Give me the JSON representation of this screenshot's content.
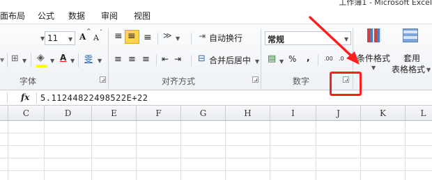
{
  "window": {
    "title_fragment": "工作簿1 - Microsoft Excel"
  },
  "tabs": [
    "面布局",
    "公式",
    "数据",
    "审阅",
    "视图"
  ],
  "font_group": {
    "font_size": "11",
    "grow_font": "A",
    "shrink_font": "A",
    "font_color_letter": "A",
    "phonetic": "雯",
    "label": "字体"
  },
  "alignment_group": {
    "orientation": "≫",
    "wrap_text": "自动换行",
    "merge_center": "合并后居中",
    "label": "对齐方式"
  },
  "number_group": {
    "format": "常规",
    "percent": "%",
    "comma": ",",
    "increase_decimal": ".00",
    "decrease_decimal": ".0",
    "label": "数字"
  },
  "styles_group": {
    "conditional_formatting": "条件格式",
    "format_as_table_line1": "套用",
    "format_as_table_line2": "表格格式"
  },
  "formula_bar": {
    "fx": "fx",
    "value": "5.11244822498522E+22"
  },
  "columns": [
    "C",
    "D",
    "E",
    "F",
    "G",
    "H",
    "I",
    "J",
    "K",
    "L"
  ],
  "colors": {
    "annotation_red": "#ff1e1e",
    "active_align": "#ffd34e"
  }
}
